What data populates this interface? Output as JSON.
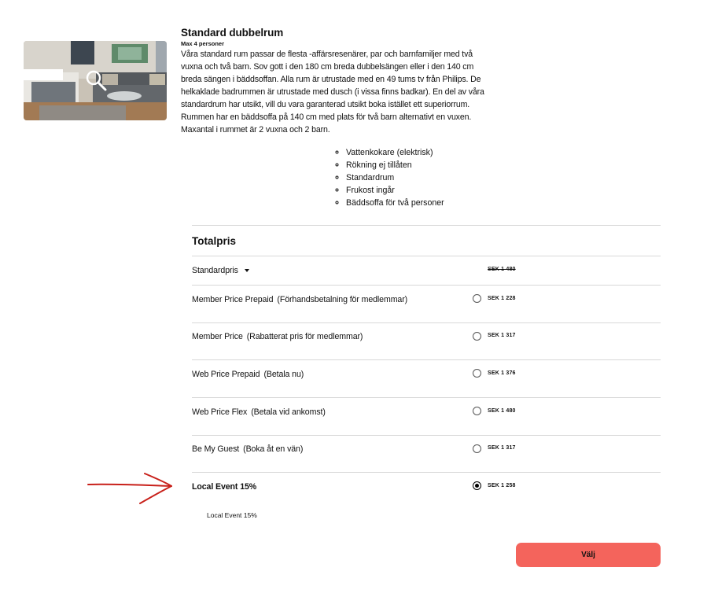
{
  "room": {
    "title": "Standard dubbelrum",
    "capacity": "Max 4 personer",
    "description": "Våra standard rum passar de flesta -affärsresenärer, par och barnfamiljer med två vuxna och två barn. Sov gott i den 180 cm breda dubbelsängen eller i den 140 cm breda sängen i bäddsoffan. Alla rum är utrustade med en 49 tums tv från Philips. De helkaklade badrummen är utrustade med dusch (i vissa finns badkar). En del av våra standardrum har utsikt, vill du vara garanterad utsikt boka istället ett superiorrum. Rummen har en bäddsoffa på 140 cm med plats för två barn alternativt en vuxen. Maxantal i rummet är 2 vuxna och 2 barn.",
    "amenities": [
      "Vattenkokare (elektrisk)",
      "Rökning ej tillåten",
      "Standardrum",
      "Frukost ingår",
      "Bäddsoffa för två personer"
    ]
  },
  "pricing": {
    "heading": "Totalpris",
    "standard": {
      "label": "Standardpris",
      "price": "SEK 1 480"
    },
    "rates": [
      {
        "name": "Member Price Prepaid",
        "detail": "(Förhandsbetalning för medlemmar)",
        "price": "SEK 1 228",
        "selected": false
      },
      {
        "name": "Member Price",
        "detail": "(Rabatterat pris för medlemmar)",
        "price": "SEK 1 317",
        "selected": false
      },
      {
        "name": "Web Price Prepaid",
        "detail": "(Betala nu)",
        "price": "SEK 1 376",
        "selected": false
      },
      {
        "name": "Web Price Flex",
        "detail": "(Betala vid ankomst)",
        "price": "SEK 1 480",
        "selected": false
      },
      {
        "name": "Be My Guest",
        "detail": "(Boka åt en vän)",
        "price": "SEK 1 317",
        "selected": false
      },
      {
        "name": "Local Event 15%",
        "detail": "",
        "price": "SEK 1 258",
        "selected": true
      }
    ],
    "selected_note": "Local Event 15%"
  },
  "actions": {
    "select_label": "Välj",
    "select_color": "#f4645c"
  },
  "annotation": {
    "arrow_color": "#c8201a"
  }
}
